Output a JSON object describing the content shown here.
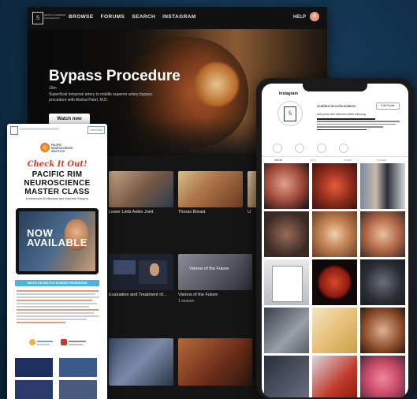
{
  "desktop": {
    "logo_text": "SEATTLE SCIENCE FOUNDATION",
    "nav": [
      "BROWSE",
      "FORUMS",
      "SEARCH",
      "INSTAGRAM"
    ],
    "help": "HELP",
    "avatar_initial": "A",
    "hero": {
      "title": "Bypass Procedure",
      "duration": "19m",
      "description": "Superficial temporal artery to middle superior artery bypass procedure with Akshal Patel, M.D.",
      "cta": "Watch now"
    },
    "rows": [
      {
        "tiles": [
          {
            "label": "Lower Limb Ankle Joint"
          },
          {
            "label": "Thorax Breast"
          },
          {
            "label": "U"
          }
        ]
      },
      {
        "tiles": [
          {
            "label": "Evaluation and Treatment of..."
          },
          {
            "label": "Visions of the Future",
            "sub": "1 season"
          }
        ]
      }
    ],
    "tile_overlay_text": "Visions of the Future"
  },
  "email": {
    "header_button": "JOIN NOW",
    "institute_name": "PACIFIC NEUROSCIENCE INSTITUTE",
    "check_it_out": "Check It Out!",
    "title_lines": [
      "PACIFIC RIM",
      "NEUROSCIENCE",
      "MASTER CLASS"
    ],
    "subtitle": "Endoscopic Endonasal and Keyhole Surgery",
    "now_available": [
      "NOW",
      "AVAILABLE"
    ],
    "cta": "WATCH ON SEATTLE SCIENCE FOUNDATION"
  },
  "instagram": {
    "handle": "Instagram",
    "username": "seattlesciencefoundation",
    "edit_label": "Edit Profile",
    "stats": "### posts   ### followers   #### following",
    "tabs": [
      "POSTS",
      "IGTV",
      "SAVED",
      "TAGGED"
    ]
  },
  "colors": {
    "background": "#0f2c45",
    "email_accent": "#d83a2a",
    "email_button": "#4fb3e0",
    "avatar": "#e8987e"
  }
}
